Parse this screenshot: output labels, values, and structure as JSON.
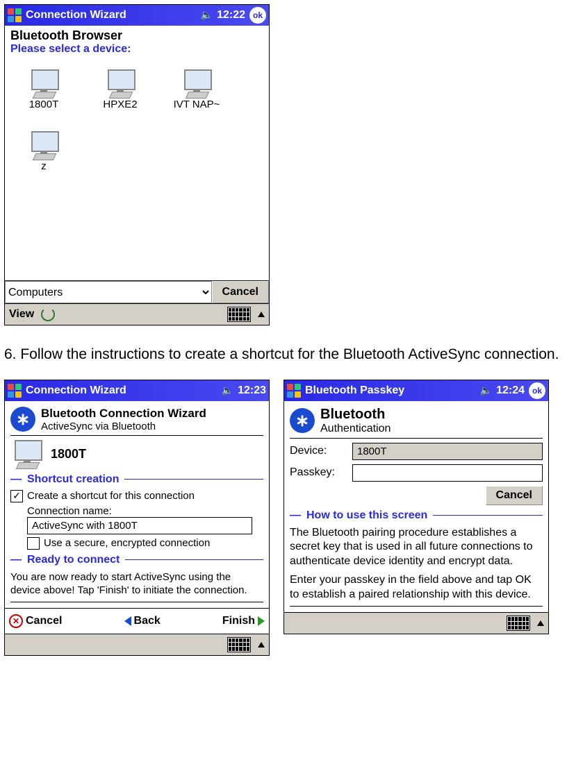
{
  "screen1": {
    "title": "Connection Wizard",
    "time": "12:22",
    "ok": "ok",
    "heading": "Bluetooth Browser",
    "subheading": "Please select a device:",
    "devices": [
      "1800T",
      "HPXE2",
      "IVT NAP~",
      "z"
    ],
    "dropdown": "Computers",
    "cancel": "Cancel",
    "view": "View"
  },
  "instruction": "6. Follow the instructions to create a shortcut for the Bluetooth ActiveSync connection.",
  "screen2": {
    "title": "Connection Wizard",
    "time": "12:23",
    "wiz_title": "Bluetooth Connection Wizard",
    "wiz_sub": "ActiveSync via Bluetooth",
    "device": "1800T",
    "section1": "Shortcut creation",
    "cb1_label": "Create a shortcut for this connection",
    "conn_name_label": "Connection name:",
    "conn_name_value": "ActiveSync with 1800T",
    "cb2_label": "Use a secure, encrypted connection",
    "section2": "Ready to connect",
    "ready_text": "You are now ready to start ActiveSync using the device above! Tap 'Finish' to initiate the connection.",
    "cancel": "Cancel",
    "back": "Back",
    "finish": "Finish"
  },
  "screen3": {
    "title": "Bluetooth Passkey",
    "time": "12:24",
    "ok": "ok",
    "bt_title": "Bluetooth",
    "bt_sub": "Authentication",
    "device_label": "Device:",
    "device_value": "1800T",
    "passkey_label": "Passkey:",
    "passkey_value": "",
    "cancel": "Cancel",
    "section": "How to use this screen",
    "para1": "The Bluetooth pairing procedure establishes a secret key that is used in all future connections to authenticate device identity and encrypt data.",
    "para2": "Enter your passkey in the field above and tap OK to establish a paired relationship with this device."
  }
}
